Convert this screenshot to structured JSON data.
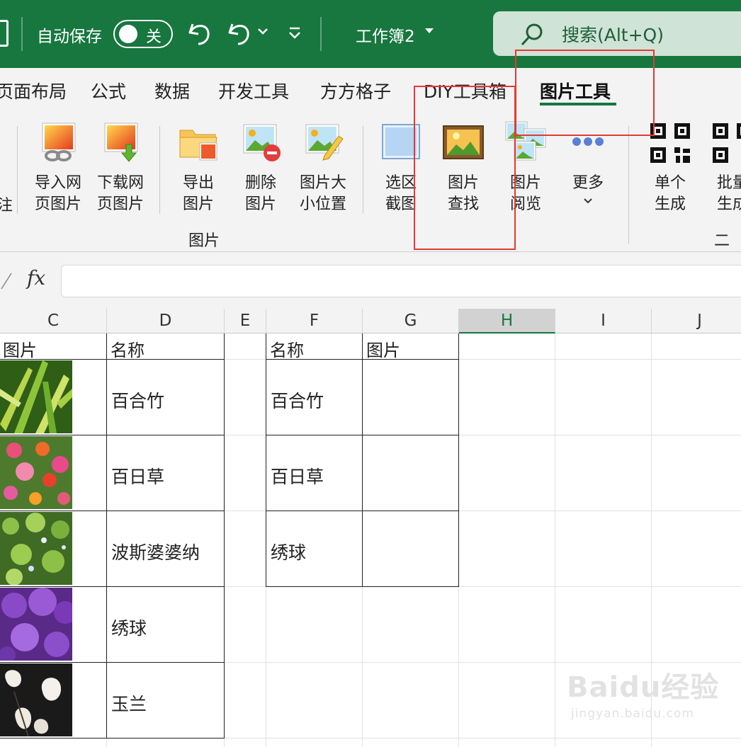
{
  "titlebar": {
    "autosave_label": "自动保存",
    "autosave_state": "关",
    "document_title": "工作簿2",
    "search_text": "搜索(Alt+Q)",
    "background": "#17773f"
  },
  "ribbon_tabs": [
    {
      "label": "页面布局",
      "active": false
    },
    {
      "label": "公式",
      "active": false
    },
    {
      "label": "数据",
      "active": false
    },
    {
      "label": "开发工具",
      "active": false
    },
    {
      "label": "方方格子",
      "active": false
    },
    {
      "label": "DIY工具箱",
      "active": false
    },
    {
      "label": "图片工具",
      "active": true
    }
  ],
  "ribbon": {
    "cut_left_label": "注",
    "buttons": [
      {
        "label": "导入网\n页图片",
        "icon": "import-web-image-icon"
      },
      {
        "label": "下载网\n页图片",
        "icon": "download-web-image-icon"
      },
      {
        "label": "导出\n图片",
        "icon": "export-image-icon"
      },
      {
        "label": "删除\n图片",
        "icon": "delete-image-icon"
      },
      {
        "label": "图片大\n小位置",
        "icon": "image-size-position-icon"
      },
      {
        "label": "选区\n截图",
        "icon": "selection-screenshot-icon"
      },
      {
        "label": "图片\n查找",
        "icon": "image-search-icon"
      },
      {
        "label": "图片\n阅览",
        "icon": "image-browse-icon"
      },
      {
        "label": "更多",
        "icon": "more-icon"
      },
      {
        "label": "单个\n生成",
        "icon": "qr-single-icon"
      },
      {
        "label": "批量\n生成",
        "icon": "qr-batch-icon"
      }
    ],
    "group_image_label": "图片",
    "group_qr_label": "二维"
  },
  "formula_bar": {
    "fx_label": "fx",
    "value": ""
  },
  "columns": [
    "C",
    "D",
    "E",
    "F",
    "G",
    "H",
    "I",
    "J"
  ],
  "selected_column": "H",
  "table_left": {
    "header_image": "图片",
    "header_name": "名称",
    "rows": [
      "百合竹",
      "百日草",
      "波斯婆婆纳",
      "绣球",
      "玉兰"
    ]
  },
  "table_right": {
    "header_name": "名称",
    "header_image": "图片",
    "rows": [
      "百合竹",
      "百日草",
      "绣球"
    ]
  },
  "watermark": {
    "main": "Baidu经验",
    "sub": "jingyan.baidu.com"
  },
  "colors": {
    "accent_green": "#17773f",
    "highlight_red": "#e53935"
  }
}
